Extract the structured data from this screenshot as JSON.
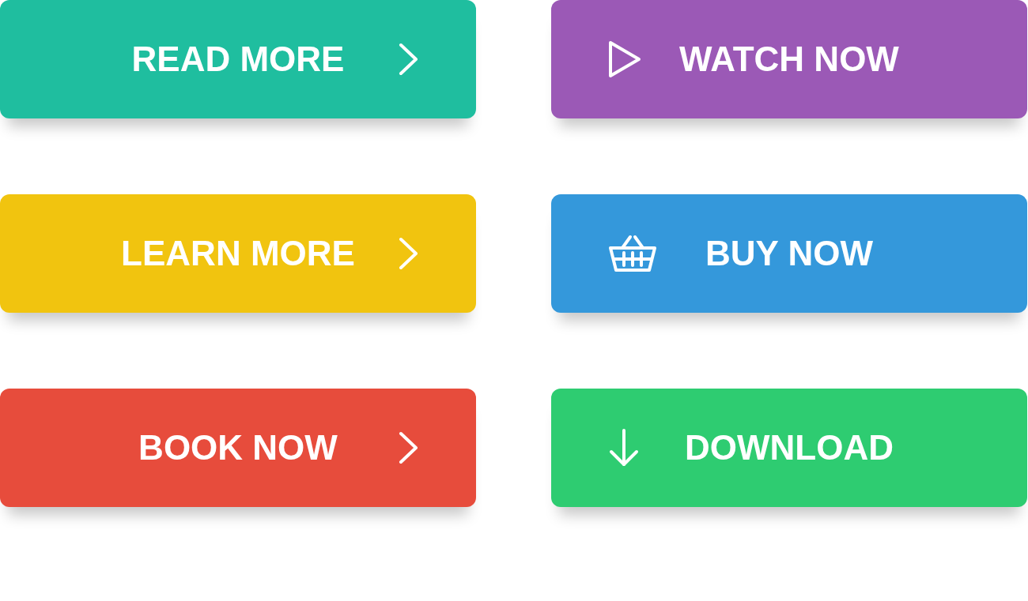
{
  "buttons": [
    {
      "label": "READ MORE",
      "color": "#1fbe9f",
      "kind": "next"
    },
    {
      "label": "WATCH NOW",
      "color": "#9b59b6",
      "kind": "play"
    },
    {
      "label": "LEARN MORE",
      "color": "#f1c40f",
      "kind": "next"
    },
    {
      "label": "BUY NOW",
      "color": "#3498db",
      "kind": "shop"
    },
    {
      "label": "BOOK NOW",
      "color": "#e74c3c",
      "kind": "next"
    },
    {
      "label": "DOWNLOAD",
      "color": "#2ecc71",
      "kind": "download"
    }
  ]
}
